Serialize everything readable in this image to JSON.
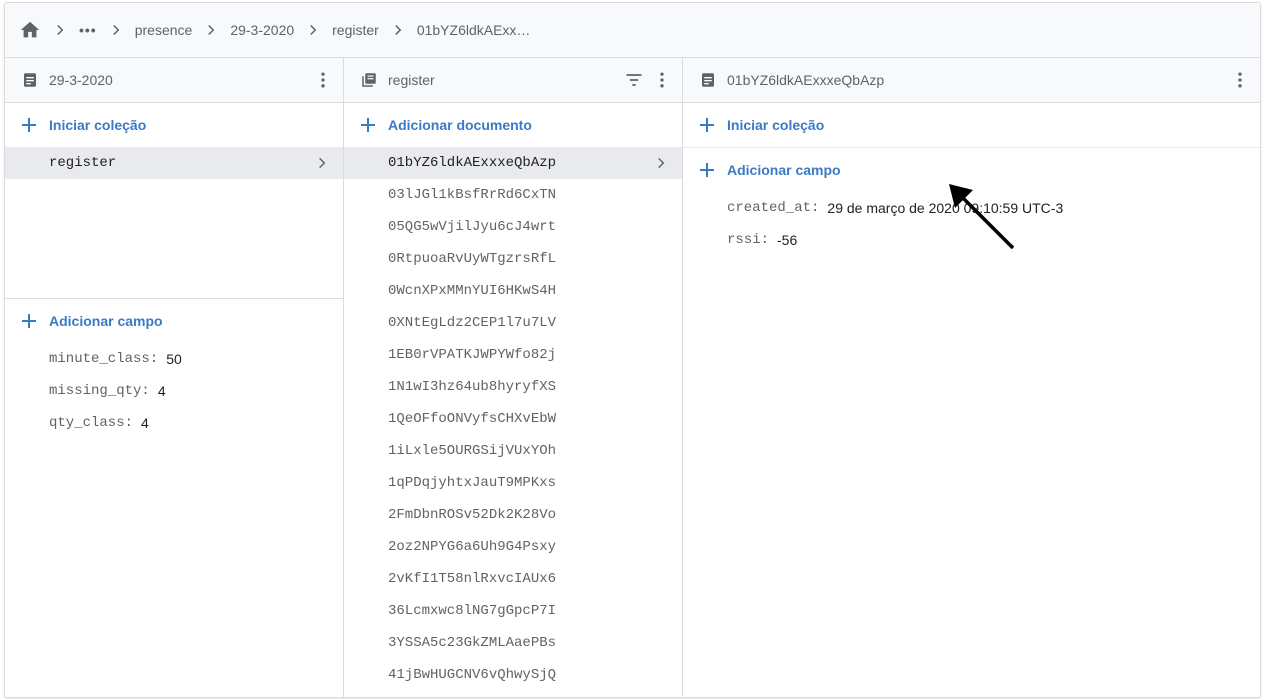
{
  "breadcrumb": {
    "ellipsis": "•••",
    "items": [
      "presence",
      "29-3-2020",
      "register",
      "01bYZ6ldkAExx…"
    ]
  },
  "col1": {
    "title": "29-3-2020",
    "start_collection": "Iniciar coleção",
    "collections": [
      {
        "label": "register",
        "selected": true
      }
    ],
    "add_field": "Adicionar campo",
    "fields": [
      {
        "name": "minute_class:",
        "value": "50"
      },
      {
        "name": "missing_qty:",
        "value": "4"
      },
      {
        "name": "qty_class:",
        "value": "4"
      }
    ]
  },
  "col2": {
    "title": "register",
    "add_document": "Adicionar documento",
    "documents": [
      "01bYZ6ldkAExxxeQbAzp",
      "03lJGl1kBsfRrRd6CxTN",
      "05QG5wVjilJyu6cJ4wrt",
      "0RtpuoaRvUyWTgzrsRfL",
      "0WcnXPxMMnYUI6HKwS4H",
      "0XNtEgLdz2CEP1l7u7LV",
      "1EB0rVPATKJWPYWfo82j",
      "1N1wI3hz64ub8hyryfXS",
      "1QeOFfoONVyfsCHXvEbW",
      "1iLxle5OURGSijVUxYOh",
      "1qPDqjyhtxJauT9MPKxs",
      "2FmDbnROSv52Dk2K28Vo",
      "2oz2NPYG6a6Uh9G4Psxy",
      "2vKfI1T58nlRxvcIAUx6",
      "36Lcmxwc8lNG7gGpcP7I",
      "3YSSA5c23GkZMLAaePBs",
      "41jBwHUGCNV6vQhwySjQ"
    ]
  },
  "col3": {
    "title": "01bYZ6ldkAExxxeQbAzp",
    "start_collection": "Iniciar coleção",
    "add_field": "Adicionar campo",
    "fields": [
      {
        "name": "created_at:",
        "value": "29 de março de 2020 09:10:59 UTC-3"
      },
      {
        "name": "rssi:",
        "value": "-56"
      }
    ]
  },
  "colors": {
    "accent": "#3b7ac4",
    "selected_bg": "#e8eaed",
    "border": "#dadce0",
    "header_bg": "#f8f9fa"
  }
}
